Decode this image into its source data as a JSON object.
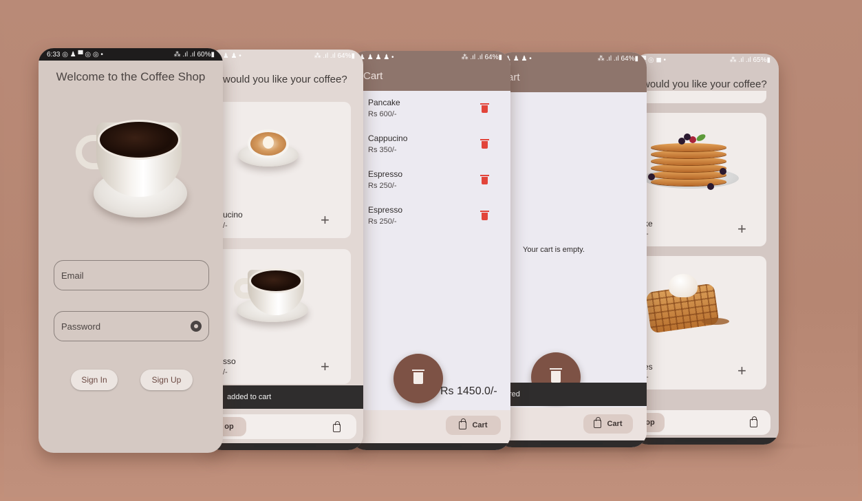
{
  "colors": {
    "background": "#b98a77",
    "cart_header": "#8e756c",
    "delete_red": "#e2443a",
    "fab": "#7d5245",
    "snackbar": "#2f2d2d"
  },
  "phone1": {
    "status_time": "6:33",
    "status_icons": "◎ ♟ ▀ ◎ ◎ •",
    "status_right": "⁂ .ıl .ıl 60%▮",
    "title": "Welcome to the Coffee Shop",
    "email_placeholder": "Email",
    "password_placeholder": "Password",
    "sign_in": "Sign In",
    "sign_up": "Sign Up",
    "eye_icon": "visibility-icon"
  },
  "phone2": {
    "status_left": "♟ ♟ ♟ •",
    "status_right": "⁂ .ıl .ıl 64%▮",
    "title": "would you like your coffee?",
    "items": [
      {
        "name": "ucino",
        "price": "/-"
      },
      {
        "name": "sso",
        "price": "/-"
      }
    ],
    "plus": "+",
    "snackbar": "added to cart",
    "nav_shop": "op"
  },
  "phone3": {
    "status_left": "♟ ♟ ♟ ♟ •",
    "status_right": "⁂ .ıl .ıl 64%▮",
    "title": "Cart",
    "items": [
      {
        "name": "Pancake",
        "price": "Rs 600/-"
      },
      {
        "name": "Cappucino",
        "price": "Rs 350/-"
      },
      {
        "name": "Espresso",
        "price": "Rs 250/-"
      },
      {
        "name": "Espresso",
        "price": "Rs 250/-"
      }
    ],
    "total_prefix": ":",
    "total": "Rs 1450.0/-",
    "nav_cart": "Cart"
  },
  "phone4": {
    "status_left": "♟ ♟ ♟ •",
    "status_right": "⁂ .ıl .ıl 64%▮",
    "title": "art",
    "empty": "Your cart is empty.",
    "snackbar": "red",
    "nav_cart": "Cart"
  },
  "phone5": {
    "status_left": "▀ ◎ ◼ •",
    "status_right": "⁂ .ıl .ıl 65%▮",
    "title": "would you like your coffee?",
    "items": [
      {
        "name": "ke",
        "price": "/-"
      },
      {
        "name": "es",
        "price": "/-"
      }
    ],
    "plus": "+",
    "nav_shop": "op"
  }
}
